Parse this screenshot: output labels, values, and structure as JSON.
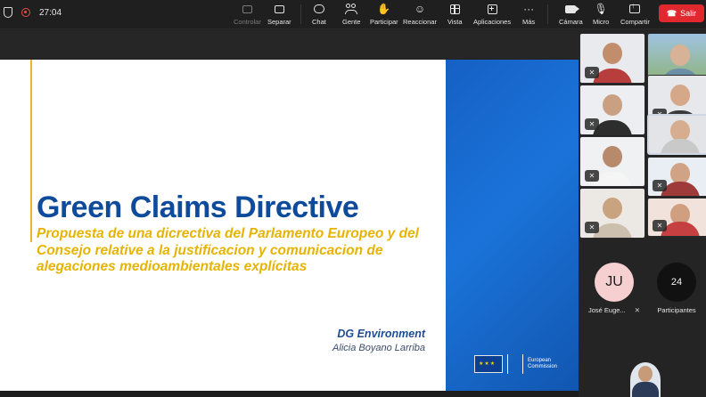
{
  "toolbar": {
    "timer": "27:04",
    "buttons": [
      {
        "id": "controlar",
        "label": "Controlar",
        "icon": "monitor-icon",
        "disabled": true
      },
      {
        "id": "separar",
        "label": "Separar",
        "icon": "pop-out-icon",
        "disabled": false
      },
      {
        "id": "chat",
        "label": "Chat",
        "icon": "chat-bubble-icon",
        "disabled": false
      },
      {
        "id": "gente",
        "label": "Gente",
        "icon": "people-icon",
        "disabled": false
      },
      {
        "id": "participar",
        "label": "Participar",
        "icon": "raise-hand-icon",
        "disabled": false
      },
      {
        "id": "reaccionar",
        "label": "Reaccionar",
        "icon": "smiley-icon",
        "disabled": false
      },
      {
        "id": "vista",
        "label": "Vista",
        "icon": "grid-view-icon",
        "disabled": false
      },
      {
        "id": "aplicaciones",
        "label": "Aplicaciones",
        "icon": "add-app-icon",
        "disabled": false
      },
      {
        "id": "mas",
        "label": "Más",
        "icon": "more-icon",
        "disabled": false
      },
      {
        "id": "camara",
        "label": "Cámara",
        "icon": "camera-off-icon",
        "disabled": false
      },
      {
        "id": "micro",
        "label": "Micro",
        "icon": "mic-off-icon",
        "disabled": false
      },
      {
        "id": "compartir",
        "label": "Compartir",
        "icon": "share-icon",
        "disabled": false
      }
    ],
    "leave_label": "Salir"
  },
  "slide": {
    "title": "Green Claims Directive",
    "subtitle": "Propuesta de una dicrectiva del Parlamento Europeo y del Consejo relative a la justificacion y comunicacion de alegaciones medioambientales explícitas",
    "organization": "DG Environment",
    "author": "Alicia Boyano Larriba",
    "logo_line1": "European",
    "logo_line2": "Commission",
    "colors": {
      "title": "#0f4b9b",
      "subtitle": "#e6b400",
      "panel_blue": "#1b73d9"
    }
  },
  "participants": {
    "tiles": [
      {
        "name": "participant-1",
        "muted": true,
        "active": false
      },
      {
        "name": "participant-2",
        "muted": false,
        "active": false
      },
      {
        "name": "participant-3",
        "muted": true,
        "active": false
      },
      {
        "name": "participant-4",
        "muted": true,
        "active": false
      },
      {
        "name": "participant-5",
        "muted": true,
        "active": false
      },
      {
        "name": "participant-6",
        "muted": false,
        "active": true
      },
      {
        "name": "participant-7",
        "muted": true,
        "active": false
      },
      {
        "name": "participant-8",
        "muted": true,
        "active": false
      },
      {
        "name": "participant-9",
        "muted": true,
        "active": false
      },
      {
        "name": "participant-10",
        "muted": true,
        "active": false
      }
    ],
    "avatar_initials": "JU",
    "avatar_name": "José Euge...",
    "count": "24",
    "count_label": "Participantes"
  }
}
